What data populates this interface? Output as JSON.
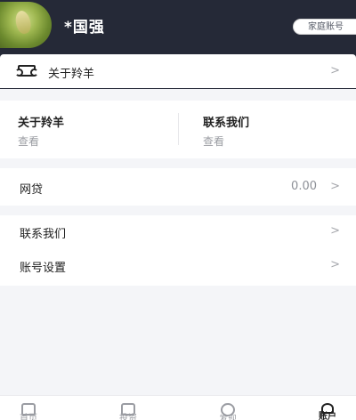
{
  "profile": {
    "username": "*国强",
    "badge": "家庭账号"
  },
  "about_row": {
    "label": "关于羚羊",
    "icon": "ticket-icon"
  },
  "quick_links": [
    {
      "title": "关于羚羊",
      "sub": "查看"
    },
    {
      "title": "联系我们",
      "sub": "查看"
    }
  ],
  "loan_row": {
    "label": "网贷",
    "amount": "0.00"
  },
  "list": [
    {
      "label": "联系我们"
    },
    {
      "label": "账号设置"
    }
  ],
  "chevron": ">",
  "tabs": [
    {
      "label": "首页",
      "icon": "home-icon",
      "active": false
    },
    {
      "label": "投资",
      "icon": "invest-icon",
      "active": false
    },
    {
      "label": "发现",
      "icon": "discover-icon",
      "active": false
    },
    {
      "label": "账户",
      "icon": "account-icon",
      "active": true
    }
  ],
  "colors": {
    "header_bg": "#252937",
    "page_bg": "#f4f5f8",
    "muted_text": "#9a9ca2"
  }
}
